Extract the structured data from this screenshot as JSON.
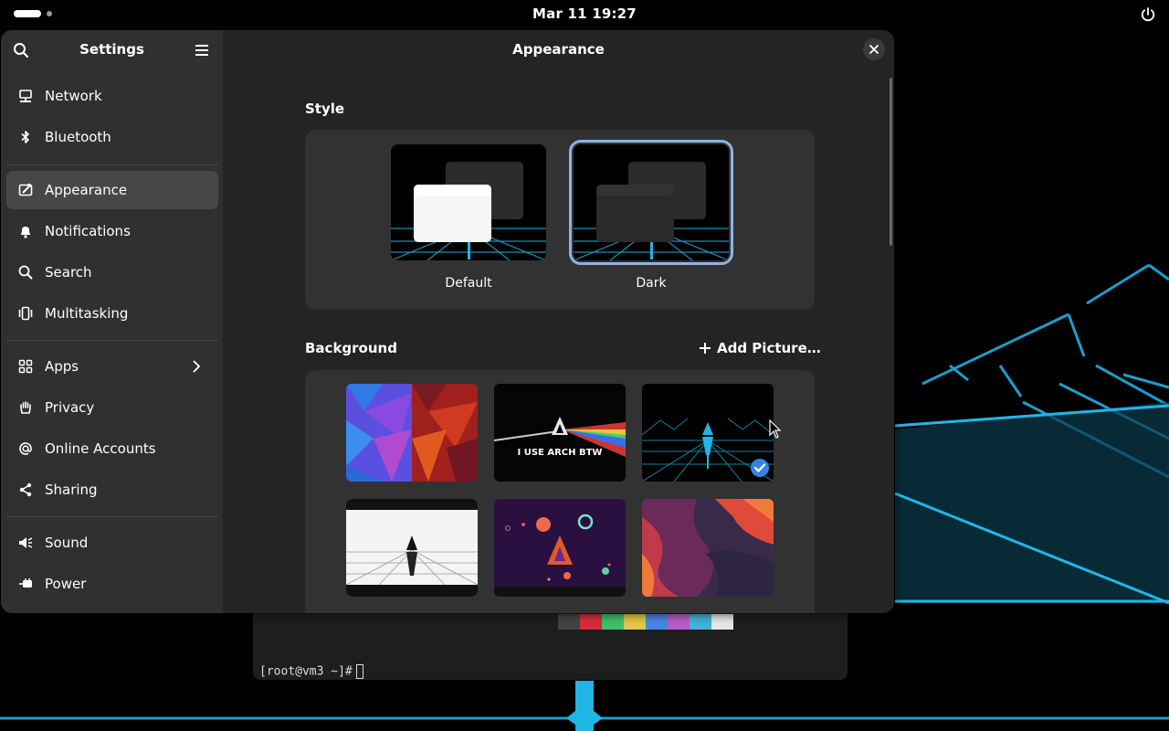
{
  "topbar": {
    "clock": "Mar 11  19:27",
    "icons": [
      "activities-indicator",
      "power-icon"
    ]
  },
  "sidebar": {
    "title": "Settings",
    "items": [
      {
        "label": "Network",
        "icon": "network-icon"
      },
      {
        "label": "Bluetooth",
        "icon": "bluetooth-icon"
      },
      {
        "label": "Appearance",
        "icon": "appearance-icon",
        "active": true
      },
      {
        "label": "Notifications",
        "icon": "bell-icon"
      },
      {
        "label": "Search",
        "icon": "search-icon"
      },
      {
        "label": "Multitasking",
        "icon": "multitasking-icon"
      },
      {
        "label": "Apps",
        "icon": "apps-grid-icon",
        "has_submenu": true
      },
      {
        "label": "Privacy",
        "icon": "hand-icon"
      },
      {
        "label": "Online Accounts",
        "icon": "at-icon"
      },
      {
        "label": "Sharing",
        "icon": "share-icon"
      },
      {
        "label": "Sound",
        "icon": "speaker-icon"
      },
      {
        "label": "Power",
        "icon": "power-plug-icon"
      }
    ]
  },
  "main": {
    "title": "Appearance",
    "style_section": {
      "label": "Style",
      "options": [
        {
          "label": "Default",
          "selected": false
        },
        {
          "label": "Dark",
          "selected": true
        }
      ]
    },
    "background_section": {
      "label": "Background",
      "add_button": "Add Picture…",
      "arch_wallpaper_text": "I USE ARCH BTW",
      "selected_index": 2
    }
  },
  "terminal": {
    "prompt": "[root@vm3 ~]#"
  },
  "colors": {
    "accent": "#8cb3e6",
    "check_badge": "#3584e4",
    "window_bg": "#242424",
    "sidebar_bg": "#303030",
    "neon": "#1fb6e6"
  }
}
